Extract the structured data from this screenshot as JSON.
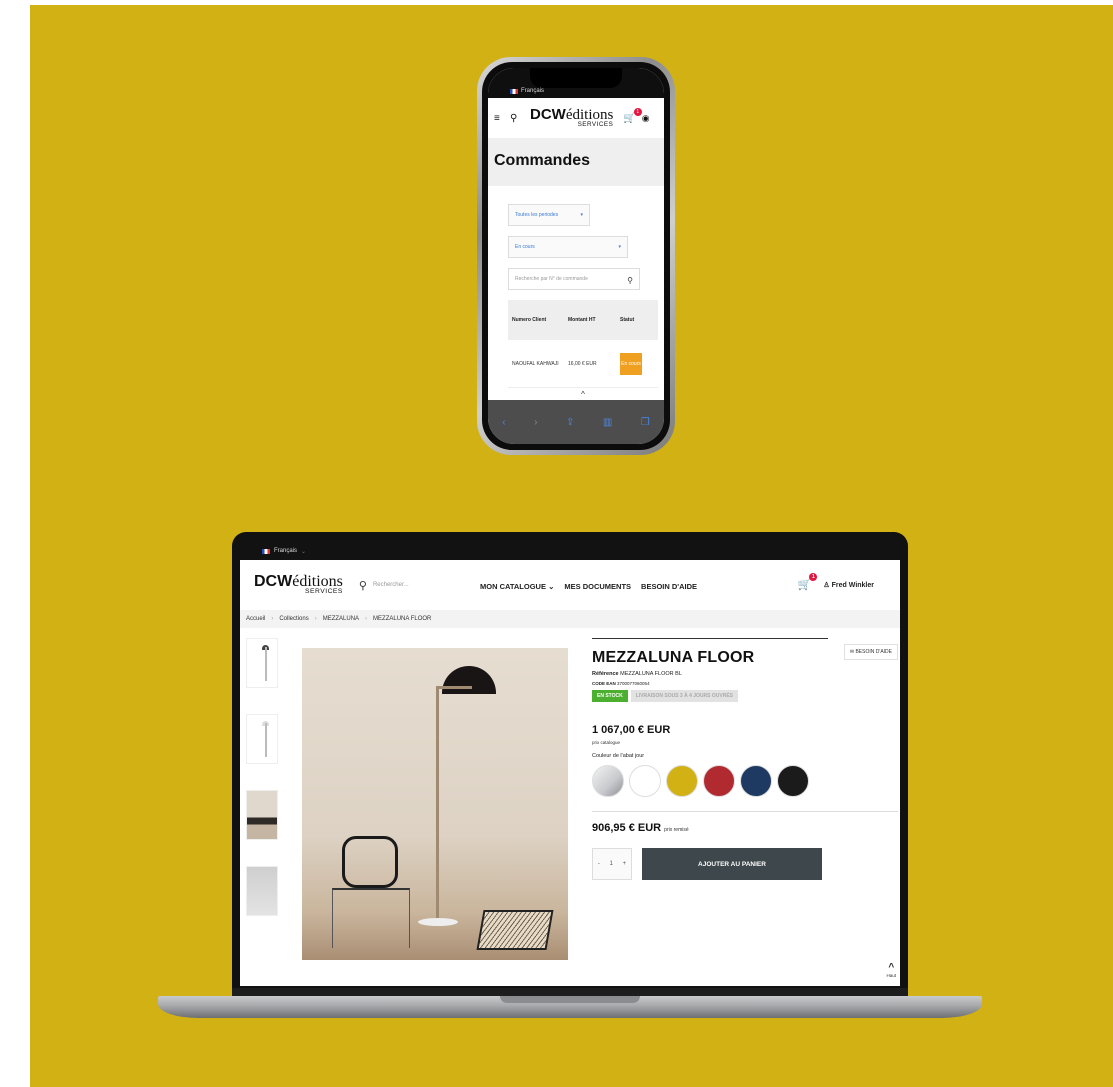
{
  "colors": {
    "background": "#d2b114",
    "accent_red": "#e3173f",
    "stock_green": "#4caf30",
    "status_orange": "#f0a020",
    "button_dark": "#3e474b"
  },
  "phone": {
    "language": "Français",
    "logo": {
      "main_bold": "DCW",
      "main_serif": "éditions",
      "sub": "SERVICES"
    },
    "cart_count": "1",
    "page_title": "Commandes",
    "filter_period": "Toutes les periodes",
    "filter_status": "En cours",
    "search_placeholder": "Recherche par N° de commande",
    "table": {
      "headers": [
        "Numero Client",
        "Montant HT",
        "Statut"
      ],
      "rows": [
        {
          "client": "NAOUFAL KAHWAJI",
          "amount": "16,00 € EUR",
          "status": "En cours"
        }
      ]
    },
    "back_to_top": "Haut"
  },
  "laptop": {
    "language": "Français",
    "logo": {
      "main_bold": "DCW",
      "main_serif": "éditions",
      "sub": "SERVICES"
    },
    "search_placeholder": "Rechercher...",
    "nav": [
      "MON CATALOGUE",
      "MES DOCUMENTS",
      "BESOIN D'AIDE"
    ],
    "cart_count": "1",
    "user_name": "Fred Winkler",
    "breadcrumb": [
      "Accueil",
      "Collections",
      "MEZZALUNA",
      "MEZZALUNA FLOOR"
    ],
    "product": {
      "name": "MEZZALUNA FLOOR",
      "reference_label": "Référence",
      "reference": "MEZZALUNA FLOOR BL",
      "ean_label": "CODE EAN",
      "ean": "3700077060054",
      "stock_tag": "EN STOCK",
      "delivery_tag": "LIVRAISON SOUS 3 À 4 JOURS OUVRÉS",
      "help_button": "BESOIN D'AIDE",
      "price": "1 067,00 € EUR",
      "price_note": "prix catalogue",
      "color_label": "Couleur de l'abat jour",
      "swatches": [
        "#c8c9cc",
        "#ffffff",
        "#d2b114",
        "#b02a30",
        "#1f3a62",
        "#1b1b1b"
      ],
      "net_price": "906,95 € EUR",
      "net_price_note": "prix remisé",
      "quantity": "1",
      "add_to_cart": "AJOUTER AU PANIER"
    },
    "back_to_top": "Haut"
  }
}
